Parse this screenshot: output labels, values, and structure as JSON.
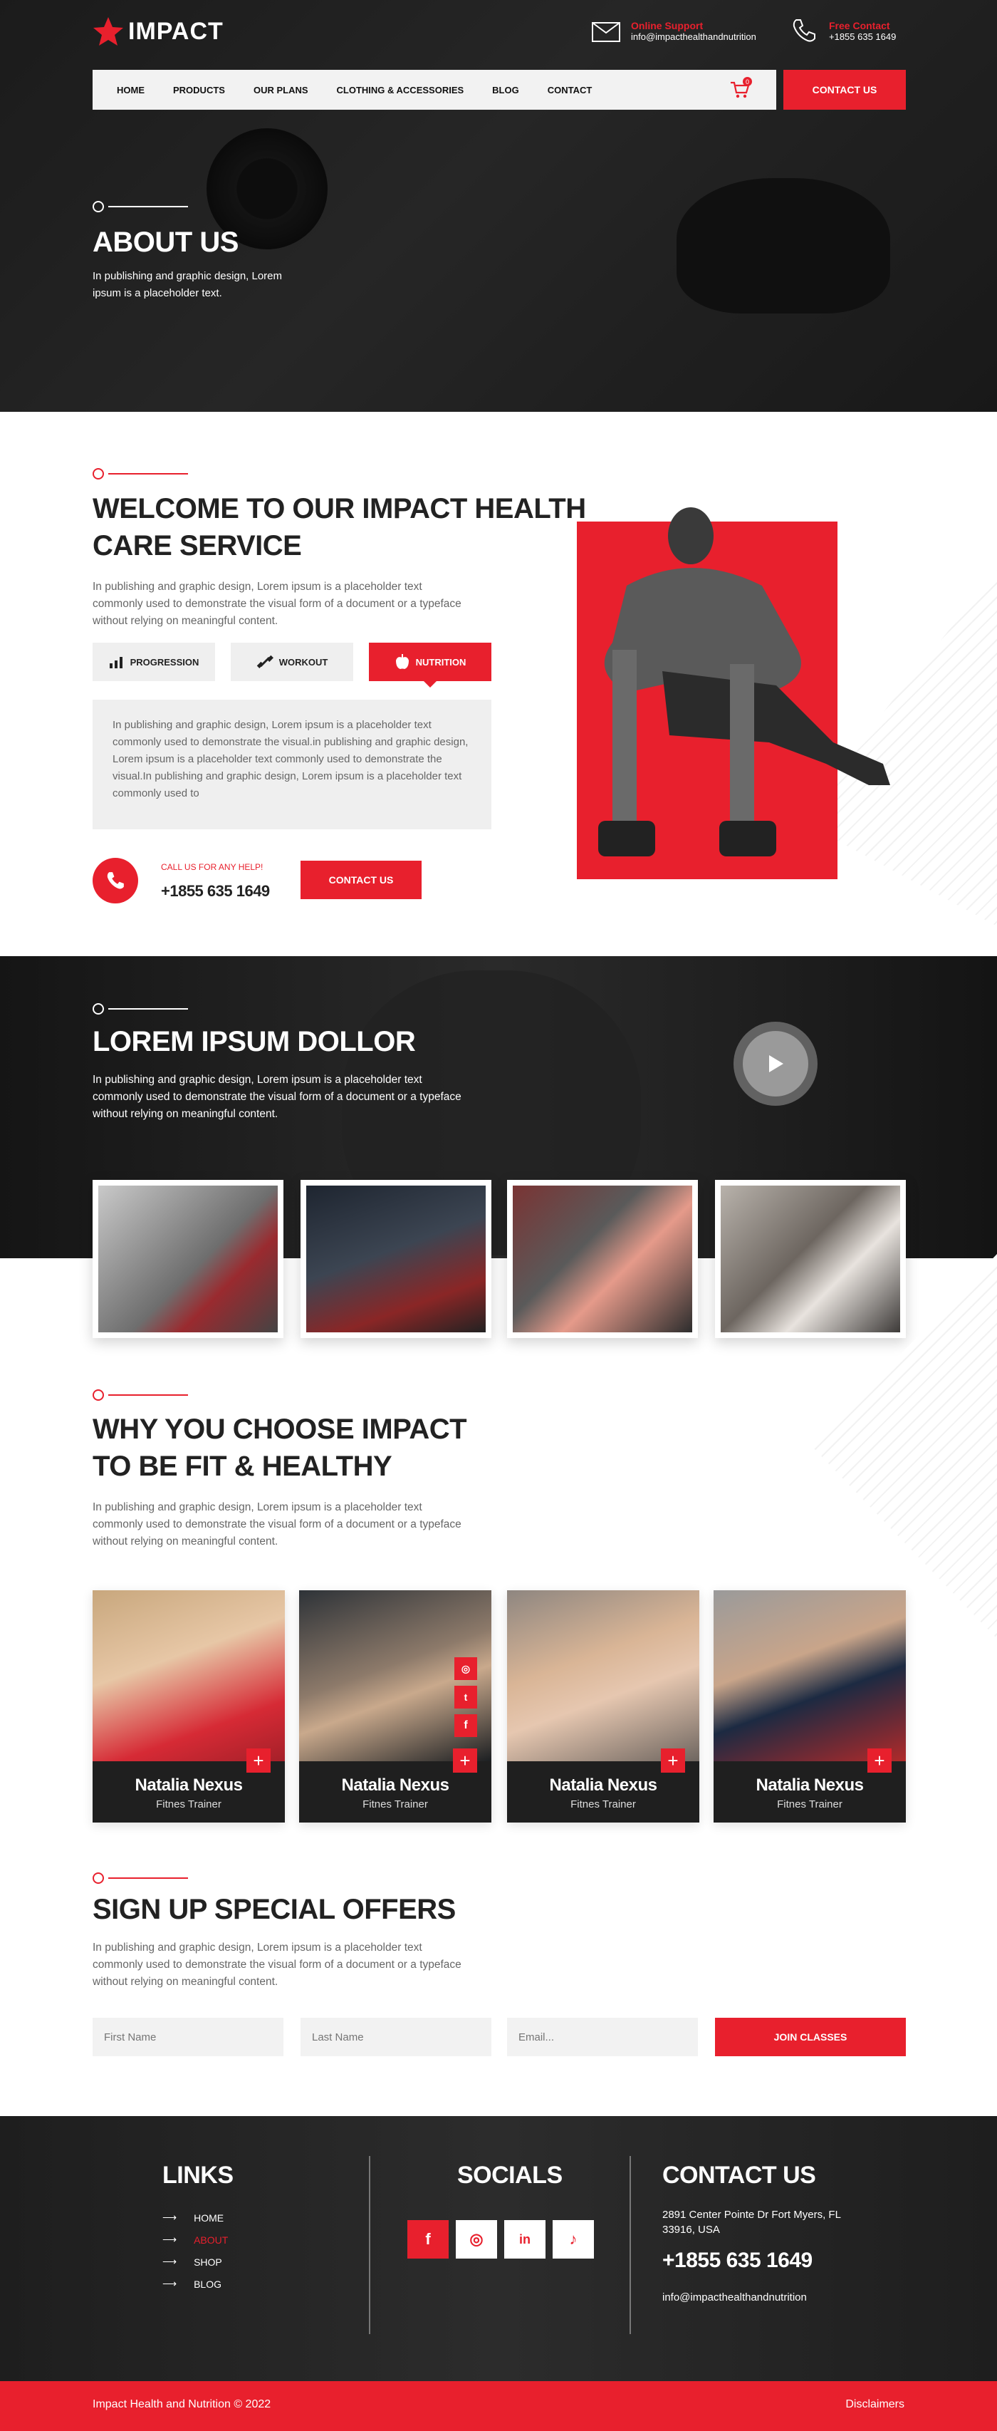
{
  "brand": {
    "logo_text": "IMPACT"
  },
  "header": {
    "support_label": "Online Support",
    "support_email": "info@impacthealthandnutrition",
    "contact_label": "Free Contact",
    "contact_phone": "+1855 635 1649"
  },
  "nav": {
    "items": [
      "HOME",
      "PRODUCTS",
      "OUR PLANS",
      "CLOTHING & ACCESSORIES",
      "BLOG",
      "CONTACT"
    ],
    "cta": "CONTACT US",
    "cart_count": "0"
  },
  "hero": {
    "title": "ABOUT US",
    "text": "In publishing and graphic design, Lorem ipsum is a placeholder text."
  },
  "welcome": {
    "title_line1": "WELCOME TO OUR IMPACT HEALTH",
    "title_line2": "CARE SERVICE",
    "text": "In publishing and graphic design, Lorem ipsum is a placeholder text commonly used to demonstrate the visual form of a document or a typeface without relying on meaningful content.",
    "tabs": [
      "PROGRESSION",
      "WORKOUT",
      "NUTRITION"
    ],
    "tab_text": "In publishing and graphic design, Lorem ipsum is a placeholder text commonly used to demonstrate the visual.in publishing and graphic design, Lorem ipsum is a placeholder text commonly used to demonstrate the visual.In publishing and graphic design, Lorem ipsum is a placeholder text commonly used to",
    "call_label": "CALL US FOR ANY HELP!",
    "call_phone": "+1855 635 1649",
    "cta": "CONTACT US"
  },
  "lorem": {
    "title": "LOREM IPSUM DOLLOR",
    "text": "In publishing and graphic design, Lorem ipsum is a placeholder text commonly used to demonstrate the visual form of a document or a typeface without relying on meaningful content."
  },
  "why": {
    "title_line1": "WHY YOU CHOOSE IMPACT",
    "title_line2": "TO BE FIT & HEALTHY",
    "text": "In publishing and graphic design, Lorem ipsum is a placeholder text commonly used to demonstrate the visual form of a document or a typeface without relying on meaningful content."
  },
  "team": [
    {
      "name": "Natalia Nexus",
      "role": "Fitnes Trainer"
    },
    {
      "name": "Natalia Nexus",
      "role": "Fitnes Trainer"
    },
    {
      "name": "Natalia Nexus",
      "role": "Fitnes Trainer"
    },
    {
      "name": "Natalia Nexus",
      "role": "Fitnes Trainer"
    }
  ],
  "signup": {
    "title": "SIGN UP SPECIAL OFFERS",
    "text": "In publishing and graphic design, Lorem ipsum is a placeholder text commonly used to demonstrate the visual form of a document or a typeface without relying on meaningful content.",
    "first_placeholder": "First Name",
    "last_placeholder": "Last Name",
    "email_placeholder": "Email...",
    "cta": "JOIN CLASSES"
  },
  "footer": {
    "links_title": "LINKS",
    "links": [
      "HOME",
      "ABOUT",
      "SHOP",
      "BLOG"
    ],
    "socials_title": "SOCIALS",
    "social_icons": [
      "facebook-icon",
      "instagram-icon",
      "linkedin-icon",
      "tiktok-icon"
    ],
    "contact_title": "CONTACT US",
    "address": "2891 Center Pointe Dr Fort Myers, FL 33916, USA",
    "phone": "+1855 635 1649",
    "email": "info@impacthealthandnutrition",
    "copyright": "Impact Health and Nutrition © 2022",
    "disclaimers": "Disclaimers"
  },
  "colors": {
    "accent": "#e8202d",
    "dark": "#1f1f1f"
  }
}
